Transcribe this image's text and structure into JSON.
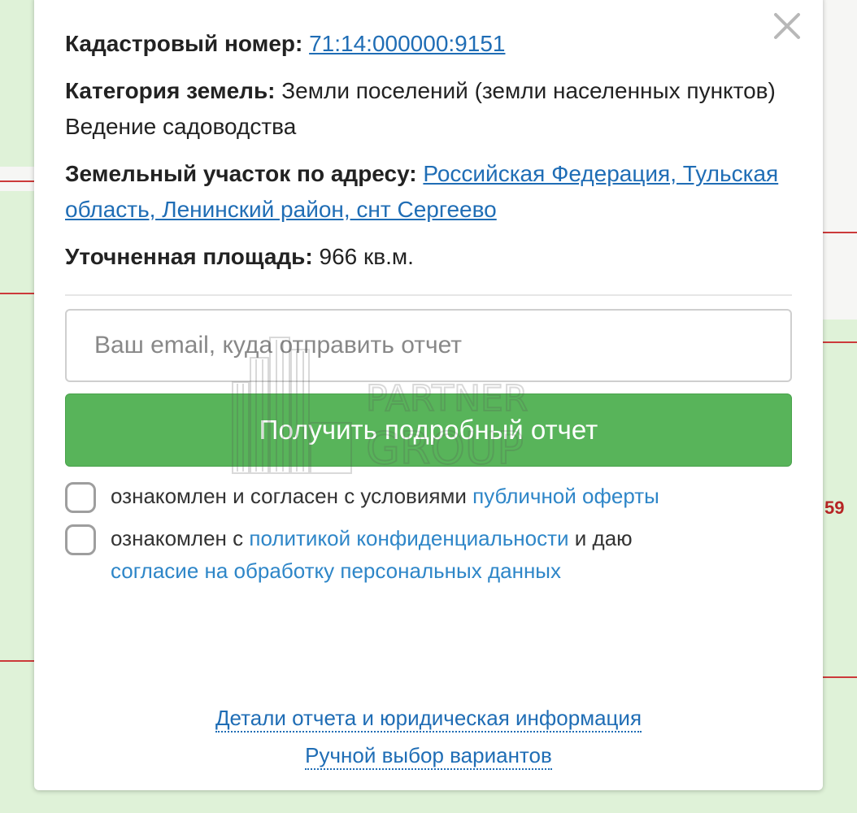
{
  "map": {
    "right_label": "59"
  },
  "popup": {
    "cadastral_label": "Кадастровый номер:",
    "cadastral_value": "71:14:000000:9151",
    "category_label": "Категория земель:",
    "category_value": "Земли поселений (земли населенных пунктов)",
    "usage": "Ведение садоводства",
    "address_label": "Земельный участок по адресу:",
    "address_value": "Российская Федерация, Тульская область, Ленинский район, снт Сергеево",
    "area_label": "Уточненная площадь:",
    "area_value": "966 кв.м.",
    "email_placeholder": "Ваш email, куда отправить отчет",
    "submit_label": "Получить подробный отчет",
    "consent1_text": "ознакомлен и согласен с условиями ",
    "consent1_link": "публичной оферты",
    "consent2_text_a": "ознакомлен с ",
    "consent2_link1": "политикой конфиденциальности",
    "consent2_text_b": " и даю ",
    "consent2_link2": "согласие на обработку персональных данных",
    "footer_link1": "Детали отчета и юридическая информация",
    "footer_link2": "Ручной выбор вариантов",
    "watermark_text_1": "PARTNER",
    "watermark_text_2": "GROUP"
  },
  "colors": {
    "map_green": "#dff2d8",
    "button_green": "#58b45a",
    "link_blue": "#1f6db5",
    "consent_blue": "#2e86c8"
  }
}
